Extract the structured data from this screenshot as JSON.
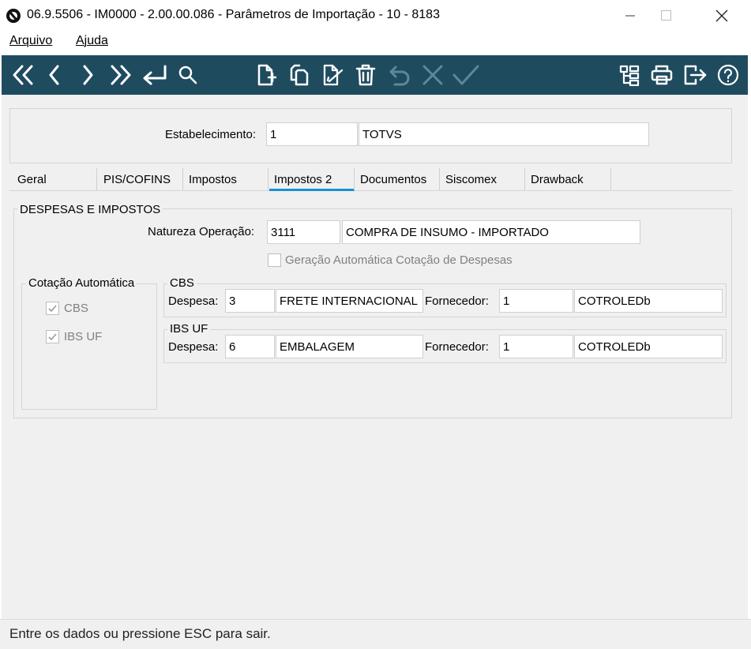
{
  "window": {
    "title": "06.9.5506 - IM0000 - 2.00.00.086 - Parâmetros de Importação - 10 - 8183"
  },
  "menu": {
    "file": "Arquivo",
    "help": "Ajuda"
  },
  "toolbar": {
    "nav_icons": [
      "first-record-icon",
      "previous-record-icon",
      "next-record-icon",
      "last-record-icon",
      "enter-icon",
      "search-icon"
    ],
    "edit_icons": [
      "new-record-icon",
      "copy-record-icon",
      "edit-record-icon",
      "delete-icon",
      "undo-icon",
      "cancel-icon",
      "confirm-icon"
    ],
    "right_icons": [
      "tree-icon",
      "print-icon",
      "exit-icon",
      "help-icon"
    ],
    "color": "#1f4b5f"
  },
  "header": {
    "establishment_label": "Estabelecimento:",
    "establishment_code": "1",
    "establishment_name": "TOTVS"
  },
  "tabs": [
    "Geral",
    "PIS/COFINS",
    "Impostos",
    "Impostos 2",
    "Documentos",
    "Siscomex",
    "Drawback"
  ],
  "active_tab": "Impostos 2",
  "active_tab_color": "#1a8fd8",
  "expenses": {
    "group_title": "DESPESAS E IMPOSTOS",
    "nature_label": "Natureza Operação:",
    "nature_code": "3111",
    "nature_desc": "COMPRA DE INSUMO - IMPORTADO",
    "auto_quote_label": "Geração Automática Cotação de Despesas",
    "auto_quote_checked": false
  },
  "auto_quote": {
    "title": "Cotação Automática",
    "cbs_label": "CBS",
    "cbs_checked": true,
    "ibs_label": "IBS UF",
    "ibs_checked": true
  },
  "cbs": {
    "title": "CBS",
    "expense_label": "Despesa:",
    "expense_code": "3",
    "expense_desc": "FRETE INTERNACIONAL",
    "supplier_label": "Fornecedor:",
    "supplier_code": "1",
    "supplier_name": "COTROLEDb"
  },
  "ibs": {
    "title": "IBS UF",
    "expense_label": "Despesa:",
    "expense_code": "6",
    "expense_desc": "EMBALAGEM",
    "supplier_label": "Fornecedor:",
    "supplier_code": "1",
    "supplier_name": "COTROLEDb"
  },
  "status": {
    "message": "Entre os dados ou pressione ESC para sair."
  }
}
